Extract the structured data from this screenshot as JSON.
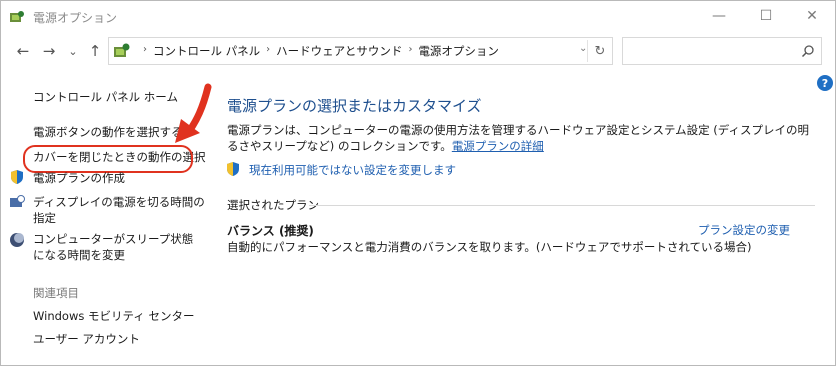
{
  "window": {
    "title": "電源オプション",
    "minimize": "—",
    "maximize": "☐",
    "close": "✕"
  },
  "nav": {
    "back": "←",
    "forward": "→",
    "recent": "⌄",
    "up": "↑"
  },
  "address": {
    "crumbs": [
      "コントロール パネル",
      "ハードウェアとサウンド",
      "電源オプション"
    ],
    "separator": "›",
    "dropdown": "⌄",
    "refresh": "↻"
  },
  "search": {
    "placeholder": ""
  },
  "help": "?",
  "left": {
    "home": "コントロール パネル ホーム",
    "power_button": "電源ボタンの動作を選択する",
    "lid": "カバーを閉じたときの動作の選択",
    "create_plan": "電源プランの作成",
    "display_off": "ディスプレイの電源を切る時間の指定",
    "sleep": "コンピューターがスリープ状態になる時間を変更",
    "related_head": "関連項目",
    "mobility": "Windows モビリティ センター",
    "user_accounts": "ユーザー アカウント"
  },
  "main": {
    "title": "電源プランの選択またはカスタマイズ",
    "desc": "電源プランは、コンピューターの電源の使用方法を管理するハードウェア設定とシステム設定 (ディスプレイの明るさやスリープなど) のコレクションです。",
    "desc_link": "電源プランの詳細",
    "change_unavailable": "現在利用可能ではない設定を変更します",
    "selected_head": "選択されたプラン",
    "plan_name": "バランス (推奨)",
    "plan_desc": "自動的にパフォーマンスと電力消費のバランスを取ります。(ハードウェアでサポートされている場合)",
    "plan_settings": "プラン設定の変更"
  },
  "colors": {
    "link": "#1f5fb0",
    "title": "#1e4f8e",
    "highlight": "#e0321f"
  }
}
